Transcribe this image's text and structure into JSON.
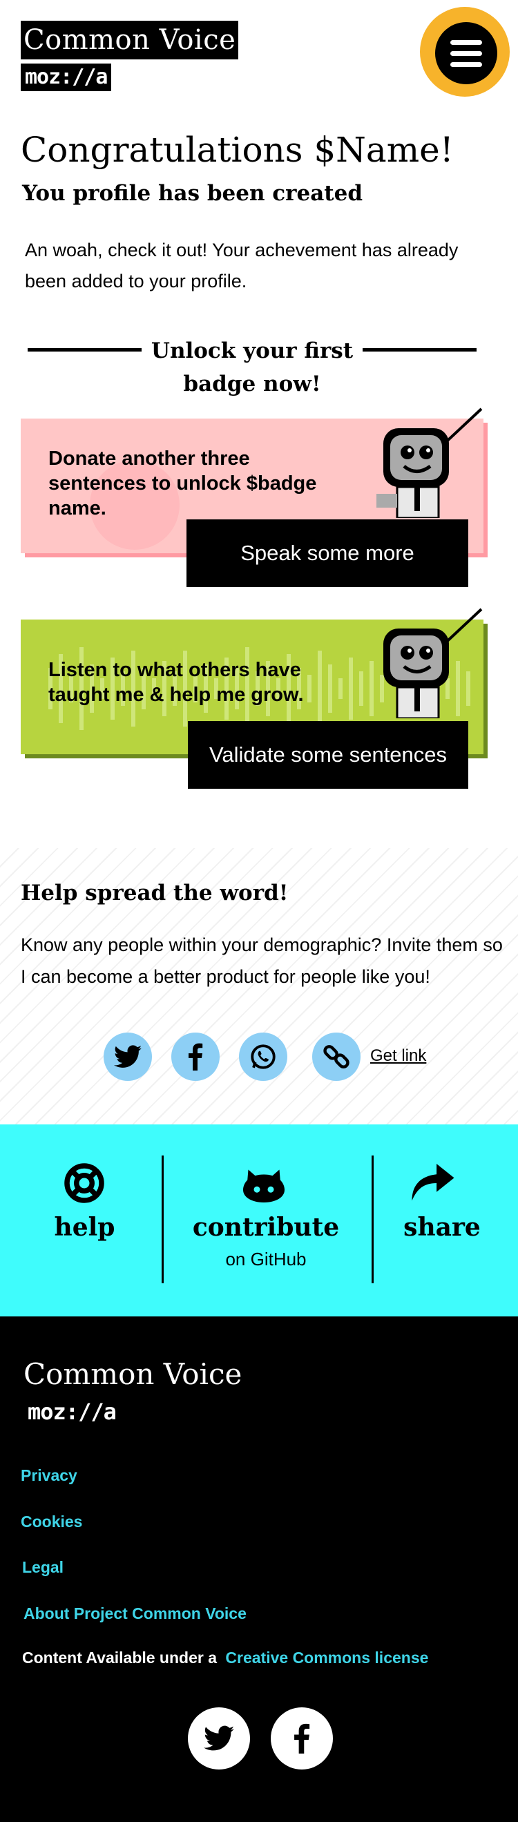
{
  "header": {
    "logo_text": "Common Voice",
    "mozilla_text": "moz://a",
    "menu_icon": "hamburger-menu-icon"
  },
  "main": {
    "title": "Congratulations $Name!",
    "subtitle": "You profile has been created",
    "intro": "An woah, check it out! Your achevement has already been added to your profile.",
    "unlock_title": "Unlock your first badge now!"
  },
  "cards": [
    {
      "text": "Donate another three sentences to unlock $badge name.",
      "button_label": "Speak some more",
      "color": "#ffc6c6",
      "shadow": "#ff9aa2"
    },
    {
      "text": "Listen to what others have taught me & help me grow.",
      "button_label": "Validate some sentences",
      "color": "#b7d43f",
      "shadow": "#6c8a1f"
    }
  ],
  "spread": {
    "title": "Help spread the word!",
    "text": "Know any people within your demographic? Invite them so I can become a better product for people like you!",
    "icons": [
      "twitter-icon",
      "facebook-icon",
      "whatsapp-icon",
      "link-icon"
    ],
    "get_link_label": "Get link"
  },
  "cta": {
    "help_label": "help",
    "contribute_label": "contribute",
    "contribute_sub": "on GitHub",
    "share_label": "share"
  },
  "footer": {
    "logo_text": "Common Voice",
    "mozilla_text": "moz://a",
    "links": [
      "Privacy",
      "Cookies",
      "Legal",
      "About Project Common Voice"
    ],
    "content_text": "Content Available under a",
    "license_link": "Creative Commons license",
    "social_icons": [
      "twitter-icon",
      "facebook-icon"
    ]
  },
  "colors": {
    "accent_yellow": "#f7b32b",
    "cyan": "#3ffcfc",
    "link_cyan": "#3fd5e8",
    "share_blue": "#8dcff5"
  }
}
